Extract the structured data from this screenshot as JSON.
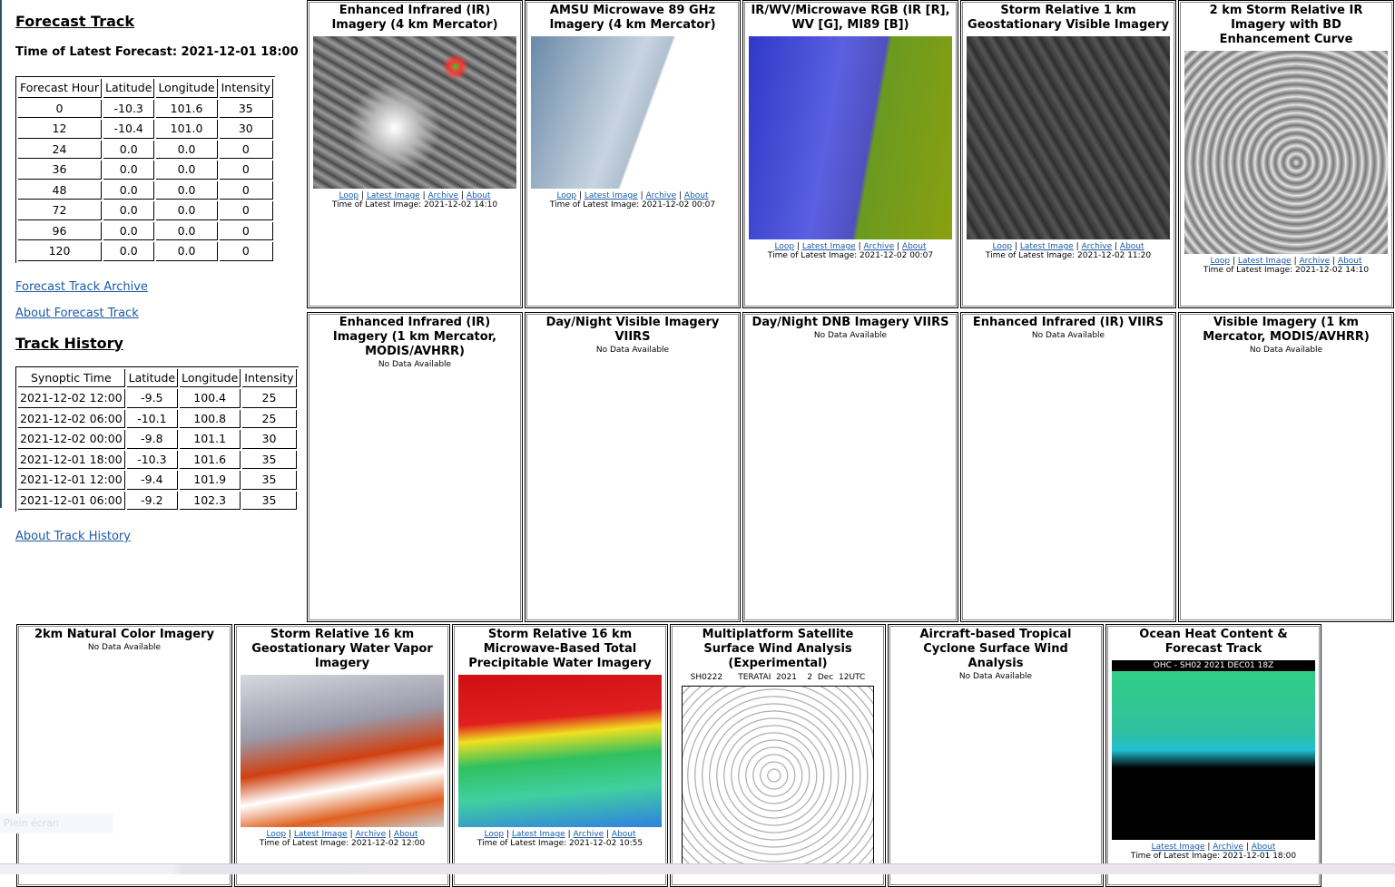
{
  "forecast": {
    "title": "Forecast Track",
    "time_label": "Time of Latest Forecast: 2021-12-01 18:00",
    "headers": [
      "Forecast Hour",
      "Latitude",
      "Longitude",
      "Intensity"
    ],
    "rows": [
      [
        "0",
        "-10.3",
        "101.6",
        "35"
      ],
      [
        "12",
        "-10.4",
        "101.0",
        "30"
      ],
      [
        "24",
        "0.0",
        "0.0",
        "0"
      ],
      [
        "36",
        "0.0",
        "0.0",
        "0"
      ],
      [
        "48",
        "0.0",
        "0.0",
        "0"
      ],
      [
        "72",
        "0.0",
        "0.0",
        "0"
      ],
      [
        "96",
        "0.0",
        "0.0",
        "0"
      ],
      [
        "120",
        "0.0",
        "0.0",
        "0"
      ]
    ],
    "archive_link": "Forecast Track Archive",
    "about_link": "About Forecast Track"
  },
  "history": {
    "title": "Track History",
    "headers": [
      "Synoptic Time",
      "Latitude",
      "Longitude",
      "Intensity"
    ],
    "rows": [
      [
        "2021-12-02 12:00",
        "-9.5",
        "100.4",
        "25"
      ],
      [
        "2021-12-02 06:00",
        "-10.1",
        "100.8",
        "25"
      ],
      [
        "2021-12-02 00:00",
        "-9.8",
        "101.1",
        "30"
      ],
      [
        "2021-12-01 18:00",
        "-10.3",
        "101.6",
        "35"
      ],
      [
        "2021-12-01 12:00",
        "-9.4",
        "101.9",
        "35"
      ],
      [
        "2021-12-01 06:00",
        "-9.2",
        "102.3",
        "35"
      ]
    ],
    "about_link": "About Track History"
  },
  "link_labels": {
    "loop": "Loop",
    "latest": "Latest Image",
    "archive": "Archive",
    "about": "About",
    "sep": " | "
  },
  "no_data": "No Data Available",
  "cells": [
    {
      "title": "Enhanced Infrared (IR) Imagery (4 km Mercator)",
      "time": "Time of Latest Image: 2021-12-02 14:10",
      "links": [
        "loop",
        "latest",
        "archive",
        "about"
      ],
      "img": "ir"
    },
    {
      "title": "AMSU Microwave 89 GHz Imagery (4 km Mercator)",
      "time": "Time of Latest Image: 2021-12-02 00:07",
      "links": [
        "loop",
        "latest",
        "archive",
        "about"
      ],
      "img": "mw"
    },
    {
      "title": "IR/WV/Microwave RGB (IR [R], WV [G], MI89 [B])",
      "time": "Time of Latest Image: 2021-12-02 00:07",
      "links": [
        "loop",
        "latest",
        "archive",
        "about"
      ],
      "img": "rgb"
    },
    {
      "title": "Storm Relative 1 km Geostationary Visible Imagery",
      "time": "Time of Latest Image: 2021-12-02 11:20",
      "links": [
        "loop",
        "latest",
        "archive",
        "about"
      ],
      "img": "vis"
    },
    {
      "title": "2 km Storm Relative IR Imagery with BD Enhancement Curve",
      "time": "Time of Latest Image: 2021-12-02 14:10",
      "links": [
        "loop",
        "latest",
        "archive",
        "about"
      ],
      "img": "bd"
    },
    {
      "title": "Enhanced Infrared (IR) Imagery (1 km Mercator, MODIS/AVHRR)",
      "nodata": true
    },
    {
      "title": "Day/Night Visible Imagery VIIRS",
      "nodata": true
    },
    {
      "title": "Day/Night DNB Imagery VIIRS",
      "nodata": true
    },
    {
      "title": "Enhanced Infrared (IR) VIIRS",
      "nodata": true
    },
    {
      "title": "Visible Imagery (1 km Mercator, MODIS/AVHRR)",
      "nodata": true
    },
    {
      "title": "2km Natural Color Imagery",
      "nodata": true
    },
    {
      "title": "Storm Relative 16 km Geostationary Water Vapor Imagery",
      "time": "Time of Latest Image: 2021-12-02 12:00",
      "links": [
        "loop",
        "latest",
        "archive",
        "about"
      ],
      "img": "wv"
    },
    {
      "title": "Storm Relative 16 km Microwave-Based Total Precipitable Water Imagery",
      "time": "Time of Latest Image: 2021-12-02 10:55",
      "links": [
        "loop",
        "latest",
        "archive",
        "about"
      ],
      "img": "tpw"
    },
    {
      "title": "Multiplatform Satellite Surface Wind Analysis (Experimental)",
      "subtitle": "SH0222      TERATAI  2021    2  Dec  12UTC",
      "img": "wind"
    },
    {
      "title": "Aircraft-based Tropical Cyclone Surface Wind Analysis",
      "nodata": true
    },
    {
      "title": "Ocean Heat Content & Forecast Track",
      "subtitle": "OHC - SH02 2021 DEC01 18Z",
      "time": "Time of Latest Image: 2021-12-01 18:00",
      "links": [
        "latest",
        "archive",
        "about"
      ],
      "img": "ohc"
    }
  ],
  "overlay": {
    "fullscreen_hint": "Plein écran"
  }
}
